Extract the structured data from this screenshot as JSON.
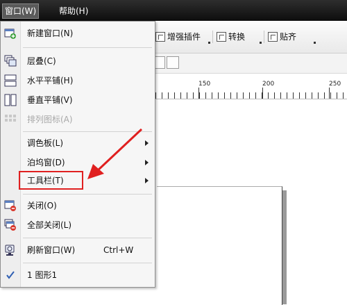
{
  "menubar": {
    "items": [
      {
        "label": "窗口(W)"
      },
      {
        "label": "帮助(H)"
      }
    ]
  },
  "toolbar": {
    "buttons": [
      {
        "label": "增强插件",
        "icon": "plugin-icon"
      },
      {
        "label": "转换",
        "icon": "convert-icon"
      },
      {
        "label": "贴齐",
        "icon": "snap-icon"
      }
    ]
  },
  "ruler": {
    "labels": [
      "150",
      "200",
      "250"
    ]
  },
  "window_menu": {
    "items": [
      {
        "label": "新建窗口(N)",
        "icon": "new-window-icon",
        "enabled": true
      },
      {
        "label": "层叠(C)",
        "icon": "cascade-icon",
        "enabled": true
      },
      {
        "label": "水平平铺(H)",
        "icon": "tile-horizontal-icon",
        "enabled": true
      },
      {
        "label": "垂直平铺(V)",
        "icon": "tile-vertical-icon",
        "enabled": true
      },
      {
        "label": "排列图标(A)",
        "icon": "arrange-icons-icon",
        "enabled": false
      },
      {
        "label": "调色板(L)",
        "submenu": true,
        "enabled": true
      },
      {
        "label": "泊坞窗(D)",
        "submenu": true,
        "enabled": true
      },
      {
        "label": "工具栏(T)",
        "submenu": true,
        "enabled": true
      },
      {
        "label": "关闭(O)",
        "icon": "close-window-icon",
        "enabled": true
      },
      {
        "label": "全部关闭(L)",
        "icon": "close-all-icon",
        "enabled": true
      },
      {
        "label": "刷新窗口(W)",
        "icon": "refresh-window-icon",
        "shortcut": "Ctrl+W",
        "enabled": true
      },
      {
        "label": "1 图形1",
        "icon": "check-icon",
        "checked": true,
        "enabled": true
      }
    ]
  },
  "colors": {
    "highlight": "#e02020",
    "menubar_bg": "#1a1a1a",
    "menu_bg": "#f6f6f6"
  }
}
